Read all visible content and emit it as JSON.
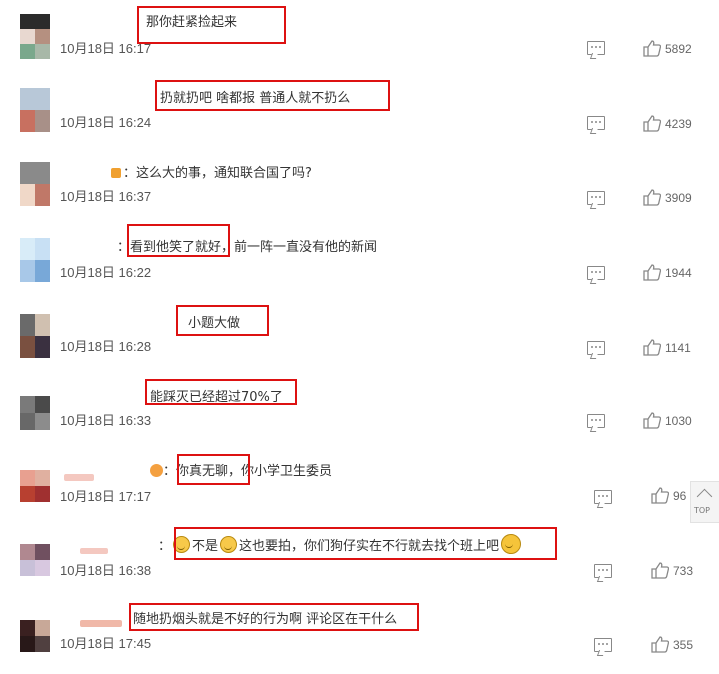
{
  "comments": [
    {
      "text": "那你赶紧捡起来",
      "time": "10月18日 16:17",
      "likes": "5892",
      "avatar": [
        "#2b2b2b",
        "#e8d8d0",
        "#b59080",
        "#7aa88c"
      ]
    },
    {
      "text": "扔就扔吧 啥都报 普通人就不扔么",
      "time": "10月18日 16:24",
      "likes": "4239",
      "avatar": [
        "#b8c8d8",
        "#c87060",
        "#a89088",
        "#3a2a2a"
      ]
    },
    {
      "text": "：这么大的事，通知联合国了吗?",
      "time": "10月18日 16:37",
      "likes": "3909",
      "avatar": [
        "#8a8a8a",
        "#3a1a1a",
        "#f0d8c8",
        "#c07868"
      ]
    },
    {
      "text": "：看到他笑了就好，前一阵一直没有他的新闻",
      "time": "10月18日 16:22",
      "likes": "1944",
      "avatar": [
        "#d8ecf8",
        "#c8e0f4",
        "#a8c8e8",
        "#78a8d8"
      ]
    },
    {
      "text": "小题大做",
      "time": "10月18日 16:28",
      "likes": "1141",
      "avatar": [
        "#6a6a6a",
        "#d0c0b0",
        "#7a5040",
        "#3a3040"
      ]
    },
    {
      "text": "能踩灭已经超过70%了",
      "time": "10月18日 16:33",
      "likes": "1030",
      "avatar": [
        "#7a7a7a",
        "#4a4a4a",
        "#686868",
        "#8c8c8c"
      ]
    },
    {
      "prefix": "：",
      "text": "你真无聊，你小学卫生委员",
      "time": "10月18日 17:17",
      "likes": "96",
      "avatar": [
        "#e8a090",
        "#e0b0a0",
        "#b84030",
        "#a03030"
      ]
    },
    {
      "text1": "不是",
      "text2": "这也要拍，你们狗仔实在不行就去找个班上吧",
      "time": "10月18日 16:38",
      "likes": "733",
      "avatar": [
        "#b08890",
        "#705060",
        "#c8c0d8",
        "#d8c8e0"
      ]
    },
    {
      "text": "随地扔烟头就是不好的行为啊 评论区在干什么",
      "time": "10月18日 17:45",
      "likes": "355",
      "avatar": [
        "#3a2020",
        "#c8a898",
        "#281818",
        "#504040"
      ]
    }
  ],
  "top_button": {
    "label": "TOP"
  },
  "colors": {
    "highlight": "#dd1111",
    "icon": "#888888"
  }
}
